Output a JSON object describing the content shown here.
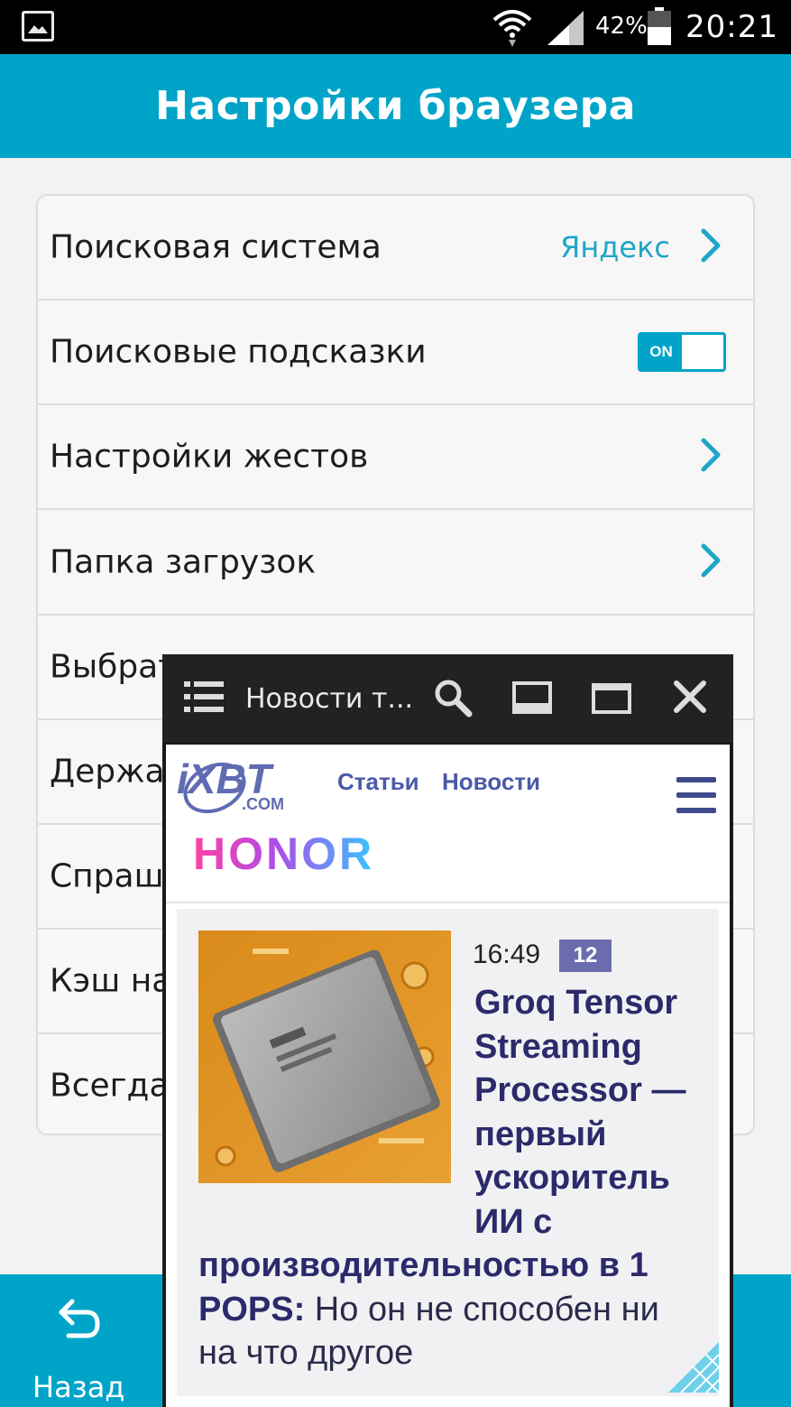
{
  "status_bar": {
    "battery_percent": "42%",
    "time": "20:21",
    "icons": [
      "gallery-icon",
      "wifi-icon",
      "signal-icon",
      "battery-icon"
    ]
  },
  "header": {
    "title": "Настройки браузера"
  },
  "settings": {
    "items": [
      {
        "label": "Поисковая система",
        "value": "Яндекс"
      },
      {
        "label": "Поисковые подсказки",
        "toggle": "ON"
      },
      {
        "label": "Настройки жестов"
      },
      {
        "label": "Папка загрузок"
      },
      {
        "label": "Выбрат"
      },
      {
        "label": "Держа"
      },
      {
        "label": "Спраши"
      },
      {
        "label": "Кэш на"
      },
      {
        "label": "Всегда"
      }
    ]
  },
  "bottom_bar": {
    "back_label": "Назад"
  },
  "floating_window": {
    "title": "Новости т...",
    "site": {
      "logo_text": "iXBT",
      "logo_sub": ".COM",
      "nav": [
        "Статьи",
        "Новости"
      ],
      "brand": "HONOR"
    },
    "news": {
      "time": "16:49",
      "badge": "12",
      "headline_bold": "Groq Tensor Streaming Processor — первый ускоритель ИИ с производительностью в 1 POPS:",
      "headline_rest": " Но он не способен ни на что другое"
    }
  },
  "colors": {
    "accent": "#00a4c9",
    "link": "#1da6c8",
    "news_title": "#2b2a6b",
    "badge": "#6a6cae"
  }
}
